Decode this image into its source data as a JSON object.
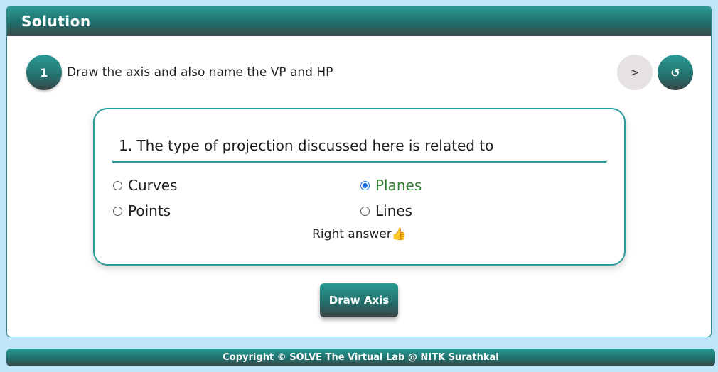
{
  "panel": {
    "title": "Solution"
  },
  "step": {
    "number": "1",
    "instruction": "Draw the axis and also name the VP and HP",
    "next_label": ">",
    "reset_label": "↺"
  },
  "quiz": {
    "question": "1. The type of projection discussed here is related to",
    "options": [
      {
        "label": "Curves",
        "selected": false
      },
      {
        "label": "Planes",
        "selected": true
      },
      {
        "label": "Points",
        "selected": false
      },
      {
        "label": "Lines",
        "selected": false
      }
    ],
    "feedback": "Right answer👍"
  },
  "actions": {
    "draw_axis_label": "Draw Axis"
  },
  "footer": {
    "copyright": "Copyright © SOLVE The Virtual Lab @ NITK Surathkal"
  },
  "colors": {
    "accent": "#2a9b95",
    "dark": "#3a4446",
    "correct": "#2e7d32",
    "background": "#bfe6fa"
  }
}
